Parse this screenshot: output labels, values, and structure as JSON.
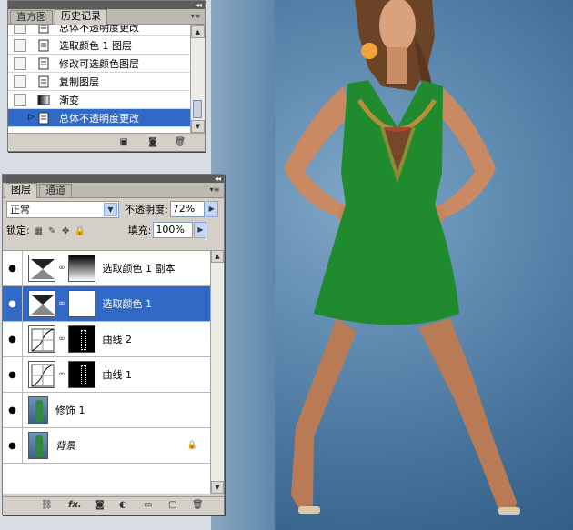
{
  "history_panel": {
    "tabs": [
      {
        "label": "直方图",
        "active": false
      },
      {
        "label": "历史记录",
        "active": true
      }
    ],
    "items": [
      {
        "label": "总体不透明度更改",
        "selected": false
      },
      {
        "label": "选取颜色 1 图层",
        "selected": false
      },
      {
        "label": "修改可选颜色图层",
        "selected": false
      },
      {
        "label": "复制图层",
        "selected": false
      },
      {
        "label": "渐变",
        "selected": false
      },
      {
        "label": "总体不透明度更改",
        "selected": true
      }
    ]
  },
  "layers_panel": {
    "tabs": [
      {
        "label": "图层",
        "active": true
      },
      {
        "label": "通道",
        "active": false
      }
    ],
    "blend_mode": "正常",
    "opacity_label": "不透明度:",
    "opacity_value": "72%",
    "lock_label": "锁定:",
    "fill_label": "填充:",
    "fill_value": "100%",
    "layers": [
      {
        "name": "选取颜色 1 副本",
        "selected": false,
        "type": "adjustment",
        "mask": "gradient"
      },
      {
        "name": "选取颜色 1",
        "selected": true,
        "type": "adjustment",
        "mask": "white"
      },
      {
        "name": "曲线 2",
        "selected": false,
        "type": "curves",
        "mask": "black-figure"
      },
      {
        "name": "曲线 1",
        "selected": false,
        "type": "curves",
        "mask": "black-figure"
      },
      {
        "name": "修饰 1",
        "selected": false,
        "type": "photo"
      },
      {
        "name": "背景",
        "selected": false,
        "type": "photo",
        "locked": true
      }
    ],
    "footer_icons": [
      "link-icon",
      "fx-icon",
      "mask-icon",
      "adjustment-icon",
      "group-icon",
      "new-layer-icon",
      "trash-icon"
    ]
  },
  "colors": {
    "selection": "#3169c6",
    "panel_bg": "#d4d0c8",
    "dress": "#1f8a2e",
    "backdrop": "#4e7aa3"
  }
}
